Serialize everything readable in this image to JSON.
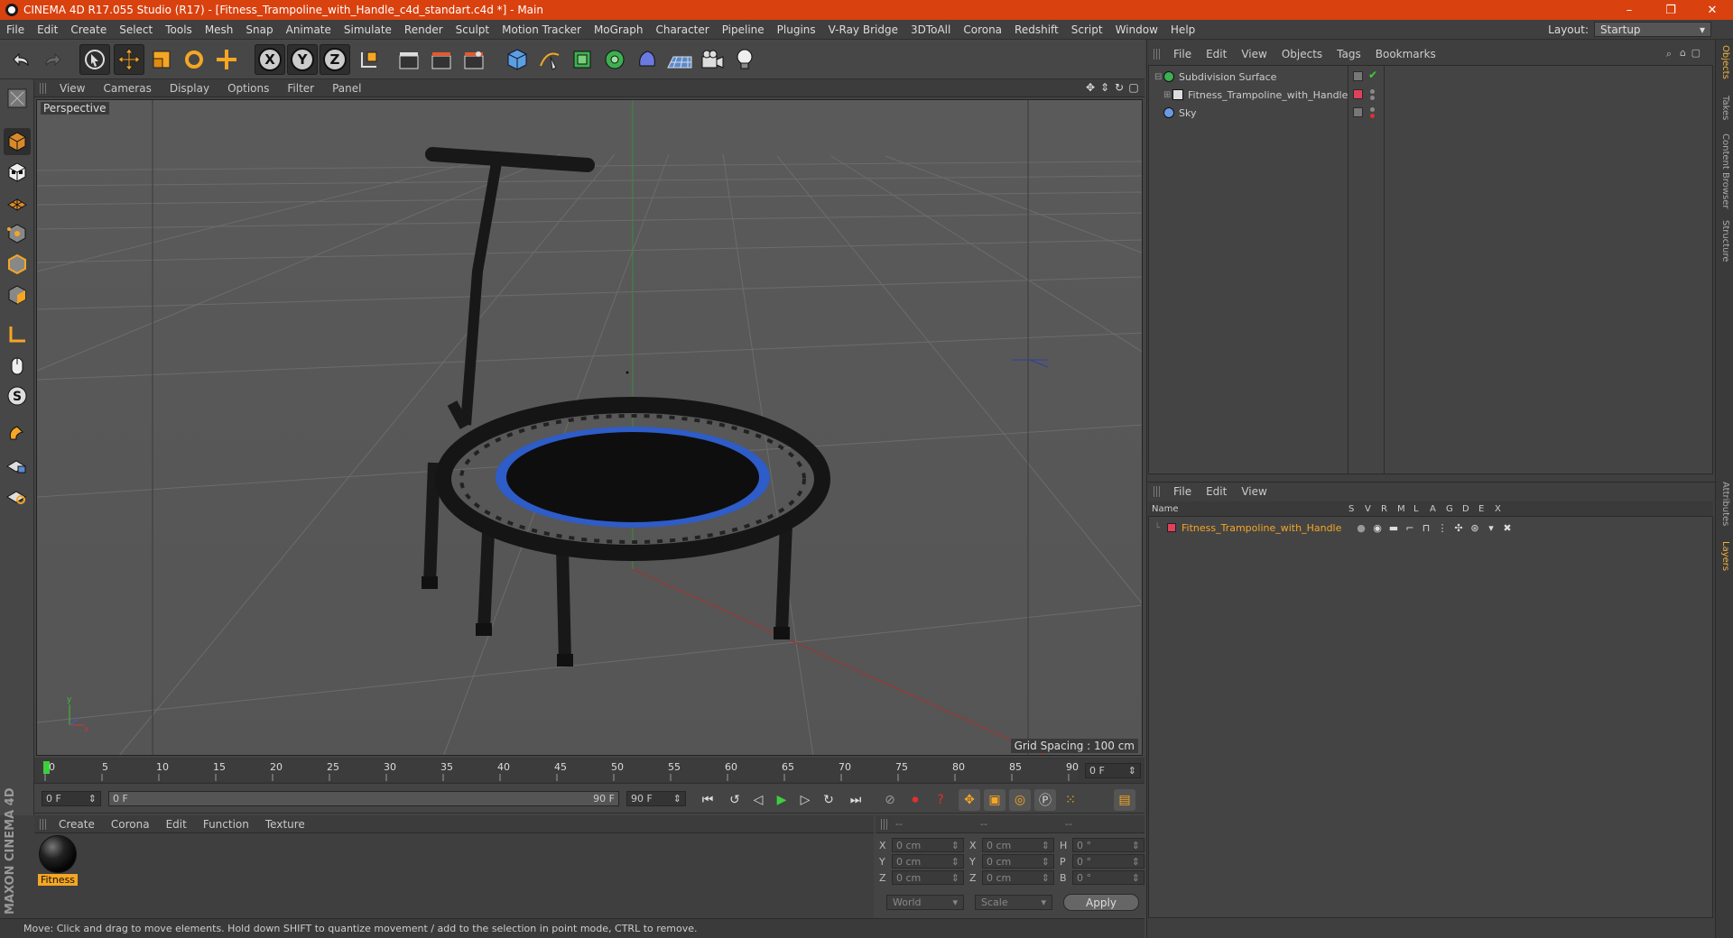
{
  "window": {
    "title": "CINEMA 4D R17.055 Studio (R17) - [Fitness_Trampoline_with_Handle_c4d_standart.c4d *] - Main",
    "controls": [
      "–",
      "❐",
      "✕"
    ]
  },
  "menubar": {
    "items": [
      "File",
      "Edit",
      "Create",
      "Select",
      "Tools",
      "Mesh",
      "Snap",
      "Animate",
      "Simulate",
      "Render",
      "Sculpt",
      "Motion Tracker",
      "MoGraph",
      "Character",
      "Pipeline",
      "Plugins",
      "V-Ray Bridge",
      "3DToAll",
      "Corona",
      "Redshift",
      "Script",
      "Window",
      "Help"
    ],
    "layout_label": "Layout:",
    "layout_value": "Startup"
  },
  "toolbar": {
    "axis_x": "X",
    "axis_y": "Y",
    "axis_z": "Z"
  },
  "viewport": {
    "menu": [
      "View",
      "Cameras",
      "Display",
      "Options",
      "Filter",
      "Panel"
    ],
    "label": "Perspective",
    "grid_spacing": "Grid Spacing : 100 cm"
  },
  "timeline": {
    "ticks": [
      "0",
      "5",
      "10",
      "15",
      "20",
      "25",
      "30",
      "35",
      "40",
      "45",
      "50",
      "55",
      "60",
      "65",
      "70",
      "75",
      "80",
      "85",
      "90"
    ],
    "current_frame": "0 F",
    "start": "0 F",
    "range_start": "0 F",
    "range_end": "90 F",
    "end": "90 F"
  },
  "material_manager": {
    "menu": [
      "Create",
      "Corona",
      "Edit",
      "Function",
      "Texture"
    ],
    "material_name": "Fitness"
  },
  "coordinates": {
    "header": [
      "--",
      "--",
      "--"
    ],
    "rows": [
      {
        "l1": "X",
        "v1": "0 cm",
        "l2": "X",
        "v2": "0 cm",
        "l3": "H",
        "v3": "0 °"
      },
      {
        "l1": "Y",
        "v1": "0 cm",
        "l2": "Y",
        "v2": "0 cm",
        "l3": "P",
        "v3": "0 °"
      },
      {
        "l1": "Z",
        "v1": "0 cm",
        "l2": "Z",
        "v2": "0 cm",
        "l3": "B",
        "v3": "0 °"
      }
    ],
    "mode": "World",
    "transform": "Scale",
    "apply": "Apply"
  },
  "branding": "MAXON CINEMA 4D",
  "status": "Move: Click and drag to move elements. Hold down SHIFT to quantize movement / add to the selection in point mode, CTRL to remove.",
  "object_manager": {
    "menu": [
      "File",
      "Edit",
      "View",
      "Objects",
      "Tags",
      "Bookmarks"
    ],
    "objects": [
      {
        "name": "Subdivision Surface"
      },
      {
        "name": "Fitness_Trampoline_with_Handle"
      },
      {
        "name": "Sky"
      }
    ]
  },
  "layer_manager": {
    "menu": [
      "File",
      "Edit",
      "View"
    ],
    "columns": [
      "Name",
      "S",
      "V",
      "R",
      "M",
      "L",
      "A",
      "G",
      "D",
      "E",
      "X"
    ],
    "layers": [
      {
        "name": "Fitness_Trampoline_with_Handle",
        "color": "#e0405a"
      }
    ]
  },
  "side_tabs": [
    "Objects",
    "Takes",
    "Content Browser",
    "Structure",
    "Attributes",
    "Layers"
  ],
  "colors": {
    "titlebar": "#d9410f",
    "accent": "#f5a623",
    "trampoline_ring": "#2e5cc8"
  }
}
